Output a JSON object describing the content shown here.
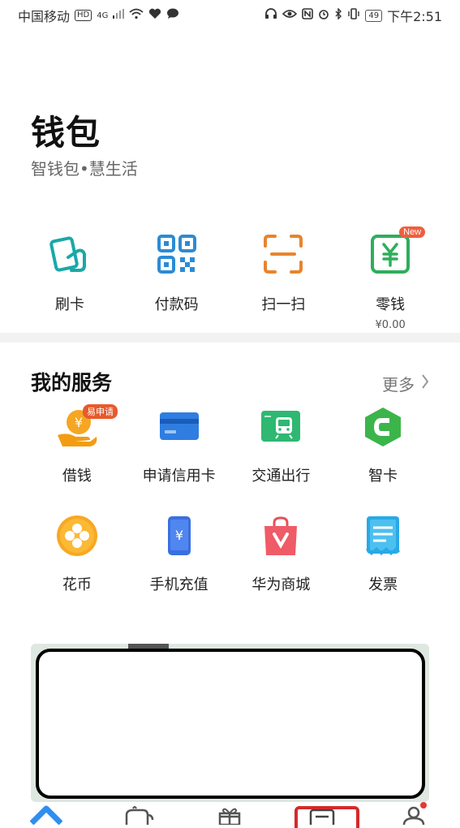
{
  "status_bar": {
    "carrier": "中国移动",
    "hd_badge": "HD",
    "network": "4G",
    "battery": "49",
    "time": "下午2:51",
    "icons": [
      "signal-icon",
      "wifi-icon",
      "heart-icon",
      "chat-icon",
      "headphones-icon",
      "eye-icon",
      "nfc-icon",
      "alarm-icon",
      "bluetooth-icon",
      "vibrate-icon"
    ]
  },
  "header": {
    "title": "钱包",
    "subtitle": "智钱包•慧生活"
  },
  "quick_actions": [
    {
      "label": "刷卡",
      "icon": "card-swipe-icon",
      "color": "#1aa8a8"
    },
    {
      "label": "付款码",
      "icon": "qr-code-icon",
      "color": "#2b8bd6"
    },
    {
      "label": "扫一扫",
      "icon": "scan-icon",
      "color": "#e8842c"
    },
    {
      "label": "零钱",
      "icon": "yuan-wallet-icon",
      "color": "#2eae5b",
      "badge": "New",
      "sub": "¥0.00"
    }
  ],
  "services": {
    "title": "我的服务",
    "more_label": "更多",
    "items": [
      {
        "label": "借钱",
        "icon": "loan-coin-icon",
        "badge": "易申请"
      },
      {
        "label": "申请信用卡",
        "icon": "credit-card-icon"
      },
      {
        "label": "交通出行",
        "icon": "transit-card-icon"
      },
      {
        "label": "智卡",
        "icon": "smart-card-icon"
      },
      {
        "label": "花币",
        "icon": "flower-coin-icon"
      },
      {
        "label": "手机充值",
        "icon": "phone-recharge-icon"
      },
      {
        "label": "华为商城",
        "icon": "shopping-bag-icon"
      },
      {
        "label": "发票",
        "icon": "invoice-icon"
      }
    ]
  },
  "bottom_nav": [
    {
      "icon": "home-icon"
    },
    {
      "icon": "coffee-cup-icon"
    },
    {
      "icon": "gift-icon"
    },
    {
      "icon": "wallet-card-icon",
      "highlighted": true
    },
    {
      "icon": "profile-icon",
      "dot": true
    }
  ]
}
